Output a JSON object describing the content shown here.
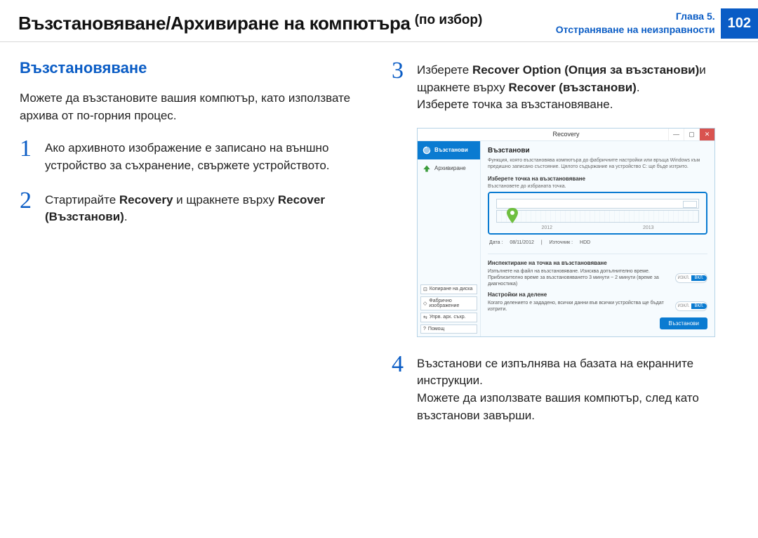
{
  "header": {
    "title": "Възстановяване/Архивиране на компютъра",
    "subtitle": "(по избор)",
    "chapter_line1": "Глава 5.",
    "chapter_line2": "Отстраняване на неизправности",
    "page_number": "102"
  },
  "left": {
    "section_heading": "Възстановяване",
    "intro": "Можете да възстановите вашия компютър, като използвате архива от по-горния процес.",
    "steps": [
      {
        "num": "1",
        "text": "Ако архивното изображение е записано на външно устройство за съхранение, свържете устройството."
      },
      {
        "num": "2",
        "text_prefix": "Стартирайте ",
        "bold1": "Recovery",
        "mid": " и щракнете върху ",
        "bold2": "Recover (Възстанови)",
        "suffix": "."
      }
    ]
  },
  "right": {
    "step3": {
      "num": "3",
      "line1_prefix": "Изберете ",
      "line1_bold": "Recover Option (Опция за възстанови)",
      "line1_mid": "и щракнете върху ",
      "line1_bold2": "Recover (възстанови)",
      "line1_suffix": ".",
      "line2": "Изберете точка за възстановяване."
    },
    "step4": {
      "num": "4",
      "line1": "Възстанови се изпълнява на базата на екранните инструкции.",
      "line2": "Можете да използвате вашия компютър, след като възстанови завърши."
    }
  },
  "screenshot": {
    "window_title": "Recovery",
    "sidebar": {
      "nav_recover": "Възстанови",
      "nav_archive": "Архивиране",
      "btn_copy": "Копиране на диска",
      "btn_factory": "Фабрично изображение",
      "btn_manage": "Упрв. арх. съхр.",
      "btn_help": "Помощ"
    },
    "main": {
      "heading": "Възстанови",
      "desc": "Функция, която възстановява компютъра до фабричните настройки или връща Windows към предишно записано състояние. Цялото съдържание на устройство C: ще бъде изтрито.",
      "sec1_title": "Изберете точка на възстановяване",
      "sec1_sub": "Възстановете до избраната точка.",
      "year_a": "2012",
      "year_b": "2013",
      "meta_date_label": "Дата :",
      "meta_date_val": "08/11/2012",
      "meta_src_label": "Източник :",
      "meta_src_val": "HDD",
      "sec2_title": "Инспектиране на точка на възстановяване",
      "opt1": "Изпълнете на файл на възстановяване. Изисква допълнително време. Приблизително време за възстановяването 3 минути ~ 2 минути (време за диагностика)",
      "sec3_title": "Настройки на делене",
      "opt2": "Когато делението е зададено, всички данни във всички устройства ще бъдат изтрити.",
      "toggle_off": "ИЗКЛ.",
      "toggle_on": "ВКЛ.",
      "primary_btn": "Възстанови"
    }
  }
}
